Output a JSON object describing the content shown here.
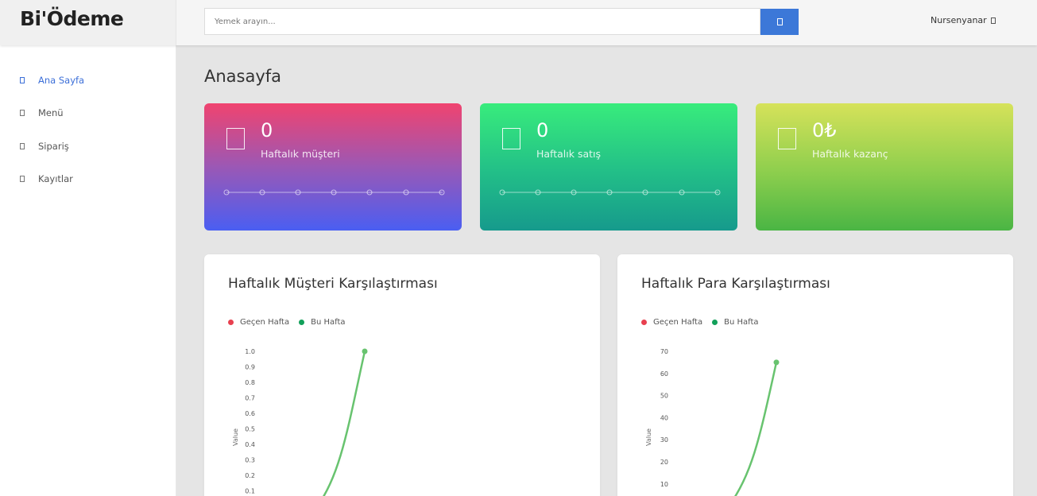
{
  "app": {
    "logo": "Bi'Ödeme"
  },
  "header": {
    "search_placeholder": "Yemek arayın...",
    "search_icon": "search-icon",
    "user_name": "Nursenyanar",
    "user_icon": "chevron-down-icon"
  },
  "sidebar": {
    "items": [
      {
        "label": "Ana Sayfa",
        "icon": "home-icon",
        "active": true
      },
      {
        "label": "Menü",
        "icon": "menu-icon",
        "active": false
      },
      {
        "label": "Sipariş",
        "icon": "order-icon",
        "active": false
      },
      {
        "label": "Kayıtlar",
        "icon": "records-icon",
        "active": false
      }
    ]
  },
  "main": {
    "title": "Anasayfa",
    "cards": [
      {
        "value": "0",
        "label": "Haftalık müşteri",
        "icon": "users-icon"
      },
      {
        "value": "0",
        "label": "Haftalık satış",
        "icon": "cart-icon"
      },
      {
        "value": "0₺",
        "label": "Haftalık kazanç",
        "icon": "money-icon"
      }
    ]
  },
  "colors": {
    "accent": "#3c78d8",
    "active_nav": "#3c6fd8",
    "previous_week": "#e8404f",
    "this_week": "#12a05a",
    "line": "#68c36f"
  },
  "chart_data": [
    {
      "type": "line",
      "title": "Haftalık Müşteri Karşılaştırması",
      "ylabel": "Value",
      "legend": [
        "Geçen Hafta",
        "Bu Hafta"
      ],
      "y_ticks": [
        "1.0",
        "0.9",
        "0.8",
        "0.7",
        "0.6",
        "0.5",
        "0.4",
        "0.3",
        "0.2",
        "0.1"
      ],
      "ylim": [
        0,
        1.0
      ],
      "series": [
        {
          "name": "Bu Hafta",
          "x": [
            0,
            1
          ],
          "values": [
            0,
            1.0
          ]
        }
      ]
    },
    {
      "type": "line",
      "title": "Haftalık Para Karşılaştırması",
      "ylabel": "Value",
      "legend": [
        "Geçen Hafta",
        "Bu Hafta"
      ],
      "y_ticks": [
        "70",
        "60",
        "50",
        "40",
        "30",
        "20",
        "10"
      ],
      "ylim": [
        0,
        70
      ],
      "series": [
        {
          "name": "Bu Hafta",
          "x": [
            0,
            1
          ],
          "values": [
            0,
            65
          ]
        }
      ]
    }
  ]
}
